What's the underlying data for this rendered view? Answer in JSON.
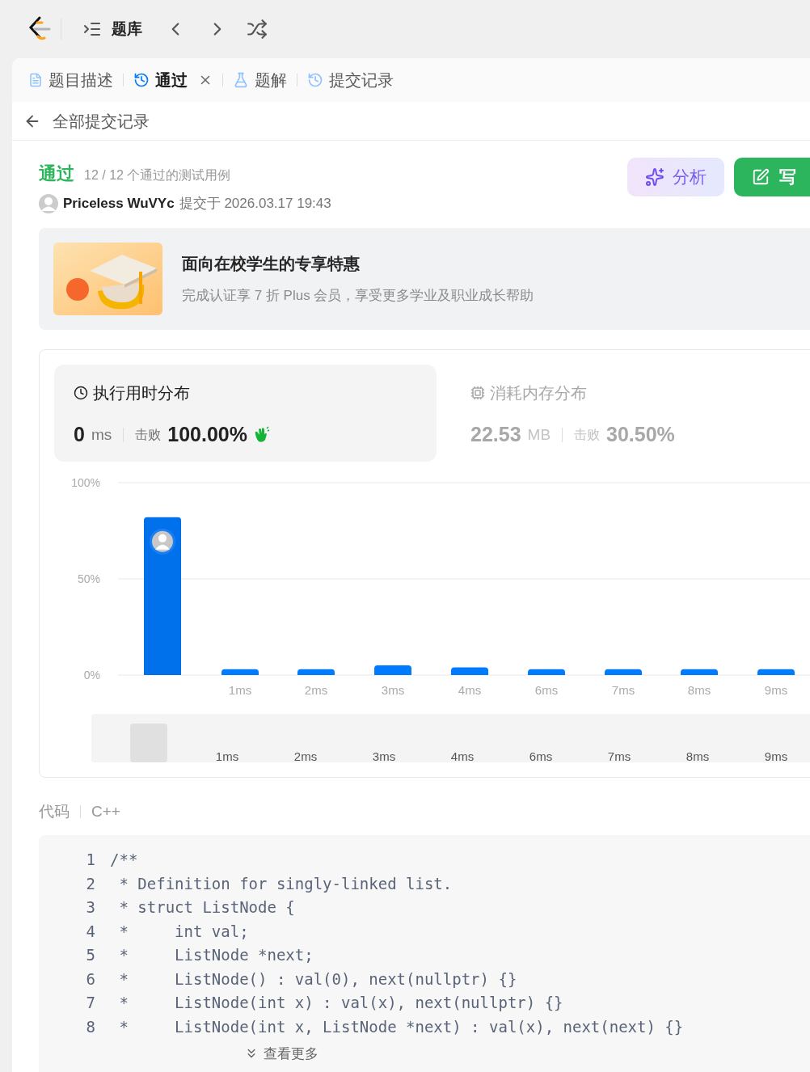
{
  "nav": {
    "title": "题库"
  },
  "tabs": [
    {
      "label": "题目描述",
      "kind": "description",
      "selected": false,
      "closable": false
    },
    {
      "label": "通过",
      "kind": "result",
      "selected": true,
      "closable": true
    },
    {
      "label": "题解",
      "kind": "solutions",
      "selected": false,
      "closable": false
    },
    {
      "label": "提交记录",
      "kind": "submissions",
      "selected": false,
      "closable": false
    }
  ],
  "back": {
    "label": "全部提交记录"
  },
  "result": {
    "status": "通过",
    "cases": "12 / 12 个通过的测试用例",
    "user": "Priceless WuVYc",
    "submitted": "提交于 2026.03.17 19:43"
  },
  "actions": [
    {
      "kind": "analyze",
      "label": "分析"
    },
    {
      "kind": "write",
      "label": "写"
    }
  ],
  "promo": {
    "title": "面向在校学生的专享特惠",
    "text": "完成认证享 7 折 Plus 会员，享受更多学业及职业成长帮助"
  },
  "stats": [
    {
      "kind": "time",
      "selected": true,
      "title": "执行用时分布",
      "value": "0",
      "unit": "ms",
      "beat_label": "击败",
      "beat": "100.00%"
    },
    {
      "kind": "memory",
      "selected": false,
      "title": "消耗内存分布",
      "value": "22.53",
      "unit": "MB",
      "beat_label": "击败",
      "beat": "30.50%"
    }
  ],
  "chart_data": {
    "type": "bar",
    "categories": [
      null,
      "1ms",
      "2ms",
      "3ms",
      "4ms",
      "6ms",
      "7ms",
      "8ms",
      "9ms"
    ],
    "values": [
      82,
      3,
      3,
      5,
      4,
      3,
      3,
      3,
      3
    ],
    "ylim": [
      0,
      100
    ],
    "yticks": [
      {
        "value": 0,
        "label": "0%"
      },
      {
        "value": 50,
        "label": "50%"
      },
      {
        "value": 100,
        "label": "100%"
      }
    ]
  },
  "overview_labels": [
    "1ms",
    "2ms",
    "3ms",
    "4ms",
    "6ms",
    "7ms",
    "8ms",
    "9ms"
  ],
  "code": {
    "label": "代码",
    "language": "C++",
    "more": "查看更多",
    "lines": [
      {
        "number": "1",
        "text": "/**"
      },
      {
        "number": "2",
        "text": " * Definition for singly-linked list."
      },
      {
        "number": "3",
        "text": " * struct ListNode {"
      },
      {
        "number": "4",
        "text": " *     int val;"
      },
      {
        "number": "5",
        "text": " *     ListNode *next;"
      },
      {
        "number": "6",
        "text": " *     ListNode() : val(0), next(nullptr) {}"
      },
      {
        "number": "7",
        "text": " *     ListNode(int x) : val(x), next(nullptr) {}"
      },
      {
        "number": "8",
        "text": " *     ListNode(int x, ListNode *next) : val(x), next(next) {}"
      }
    ]
  }
}
